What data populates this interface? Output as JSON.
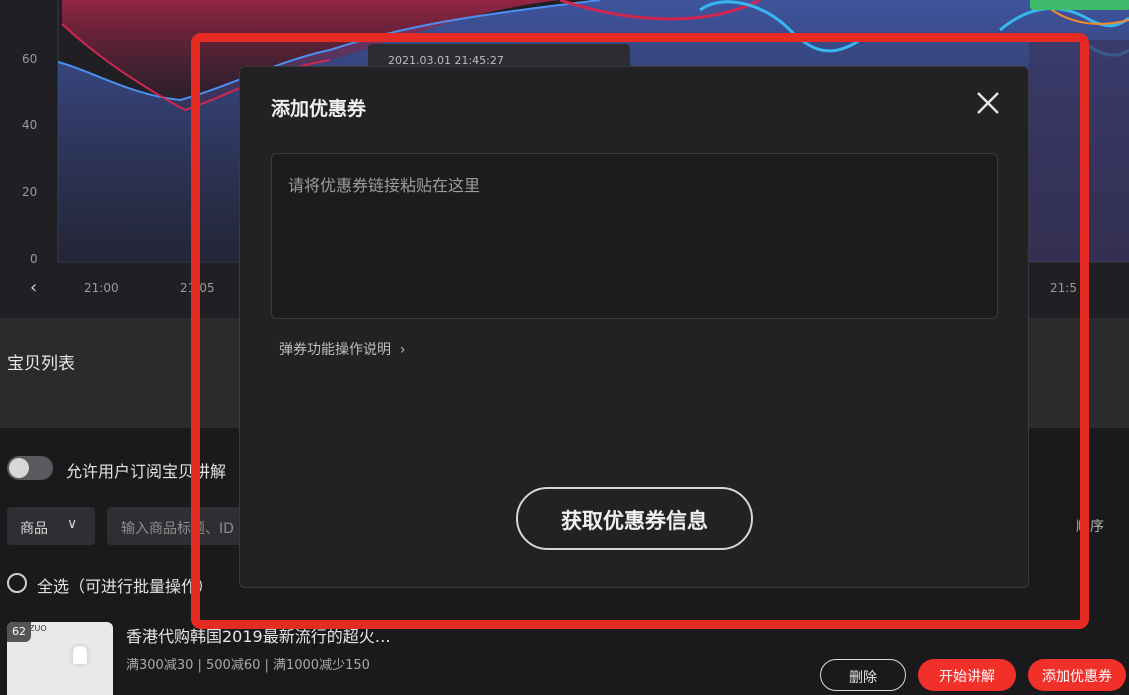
{
  "chart": {
    "y_ticks": [
      "60",
      "40",
      "20",
      "0"
    ],
    "x_ticks": [
      "21:00",
      "21:05",
      "21:5"
    ],
    "tooltip_time": "2021.03.01 21:45:27",
    "prev_icon": "chevron-left-icon"
  },
  "section": {
    "title": "宝贝列表"
  },
  "controls": {
    "subscribe_toggle_label": "允许用户订阅宝贝讲解",
    "category_value": "商品",
    "search_placeholder": "输入商品标题、ID",
    "order_label": "顺序",
    "select_all_label": "全选（可进行批量操作）"
  },
  "product": {
    "index": "62",
    "brand": "ZUO",
    "title": "香港代购韩国2019最新流行的超火…",
    "coupons": "满300减30 | 500减60 | 满1000减少150",
    "delete_label": "删除",
    "start_label": "开始讲解",
    "add_coupon_label": "添加优惠券"
  },
  "modal": {
    "title": "添加优惠券",
    "textarea_placeholder": "请将优惠券链接粘贴在这里",
    "help_link": "弹券功能操作说明",
    "submit_label": "获取优惠券信息",
    "close_icon": "close-icon"
  },
  "colors": {
    "accent_red": "#f2302a",
    "annotation_red": "#e52b22",
    "modal_bg": "#222224"
  }
}
